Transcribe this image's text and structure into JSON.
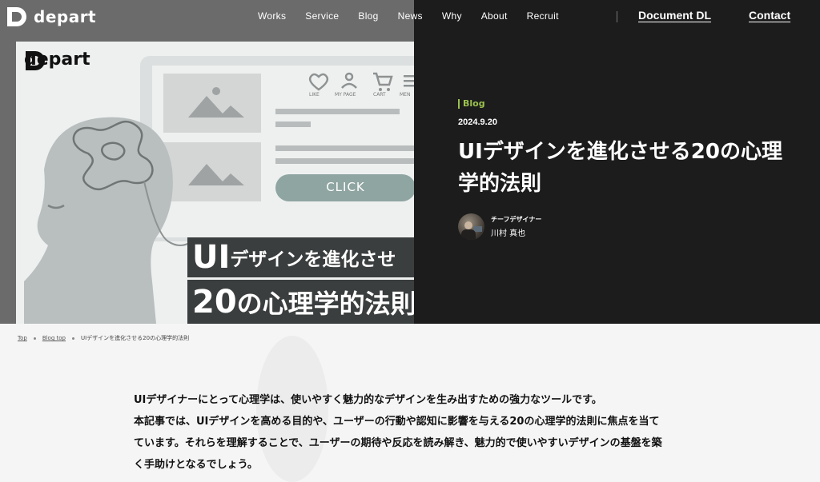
{
  "header": {
    "logo_text": "depart",
    "nav": [
      "Works",
      "Service",
      "Blog",
      "News",
      "Why",
      "About",
      "Recruit"
    ],
    "document_dl": "Document DL",
    "contact": "Contact"
  },
  "thumbnail": {
    "logo_text": "depart",
    "icons": [
      "LIKE",
      "MY PAGE",
      "CART",
      "MEN"
    ],
    "click_label": "CLICK",
    "caption_line1_big": "UI",
    "caption_line1_rest": "デザインを進化させ",
    "caption_line2_big": "20",
    "caption_line2_rest": "の心理学的法則"
  },
  "article": {
    "category": "Blog",
    "date": "2024.9.20",
    "title": "UIデザインを進化させる20の心理学的法則",
    "author_role": "チーフデザイナー",
    "author_name": "川村 真也"
  },
  "breadcrumb": {
    "top": "Top",
    "blog_top": "Blog top",
    "current": "UIデザインを進化させる20の心理学的法則"
  },
  "intro": [
    "UIデザイナーにとって心理学は、使いやすく魅力的なデザインを生み出すための強力なツールです。",
    "本記事では、UIデザインを高める目的や、ユーザーの行動や認知に影響を与える20の心理学的法則に焦点を当て",
    "ています。それらを理解することで、ユーザーの期待や反応を読み解き、魅力的で使いやすいデザインの基盤を築",
    "く手助けとなるでしょう。"
  ],
  "colors": {
    "accent": "#9bc14e",
    "dark": "#1c1c1c",
    "click_button": "#8fa5a1"
  }
}
